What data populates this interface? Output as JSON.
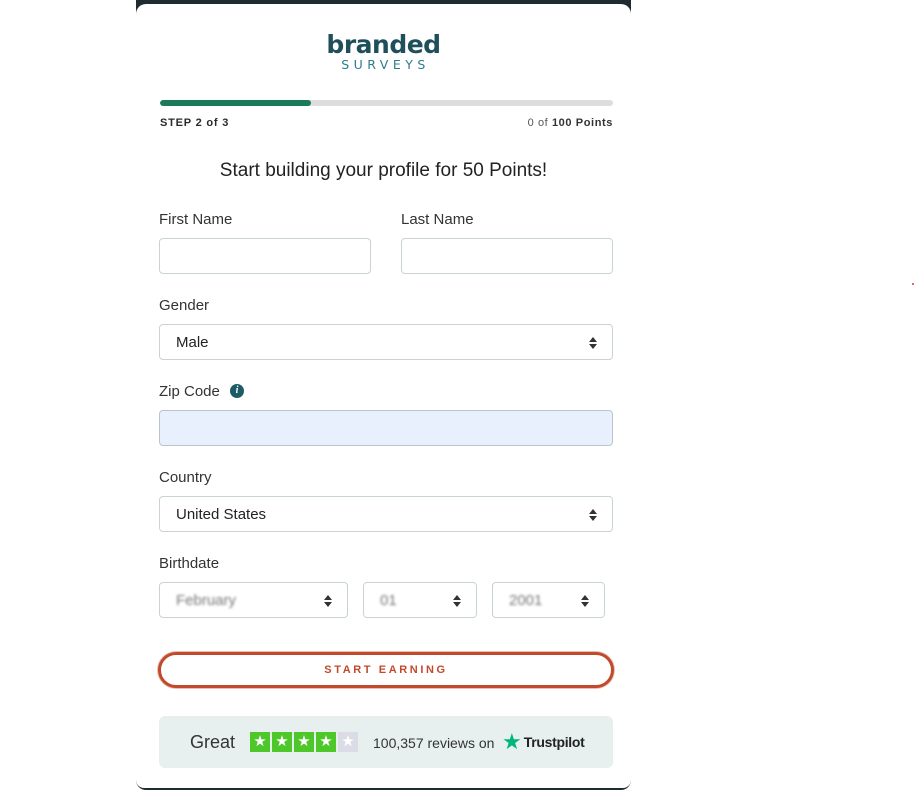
{
  "logo": {
    "main": "branded",
    "sub": "SURVEYS"
  },
  "progress": {
    "fraction": 0.333,
    "color": "#1a7a5a"
  },
  "step_text": "STEP 2 of 3",
  "points": {
    "current": "0",
    "of": "of",
    "total": "100 Points"
  },
  "headline": "Start building your profile for 50 Points!",
  "form": {
    "first_name": {
      "label": "First Name",
      "value": ""
    },
    "last_name": {
      "label": "Last Name",
      "value": ""
    },
    "gender": {
      "label": "Gender",
      "value": "Male"
    },
    "zip": {
      "label": "Zip Code",
      "value": "",
      "info_icon": "info-icon"
    },
    "country": {
      "label": "Country",
      "value": "United States"
    },
    "birthdate": {
      "label": "Birthdate",
      "month": "February",
      "day": "01",
      "year": "2001"
    }
  },
  "cta_label": "START EARNING",
  "trustpilot": {
    "rating_word": "Great",
    "stars_filled": 4,
    "stars_total": 5,
    "reviews_text": "100,357 reviews on",
    "brand": "Trustpilot"
  },
  "colors": {
    "brand": "#1e4f5b",
    "accent": "#c14a2c",
    "trustpilot_green": "#00b67a"
  }
}
